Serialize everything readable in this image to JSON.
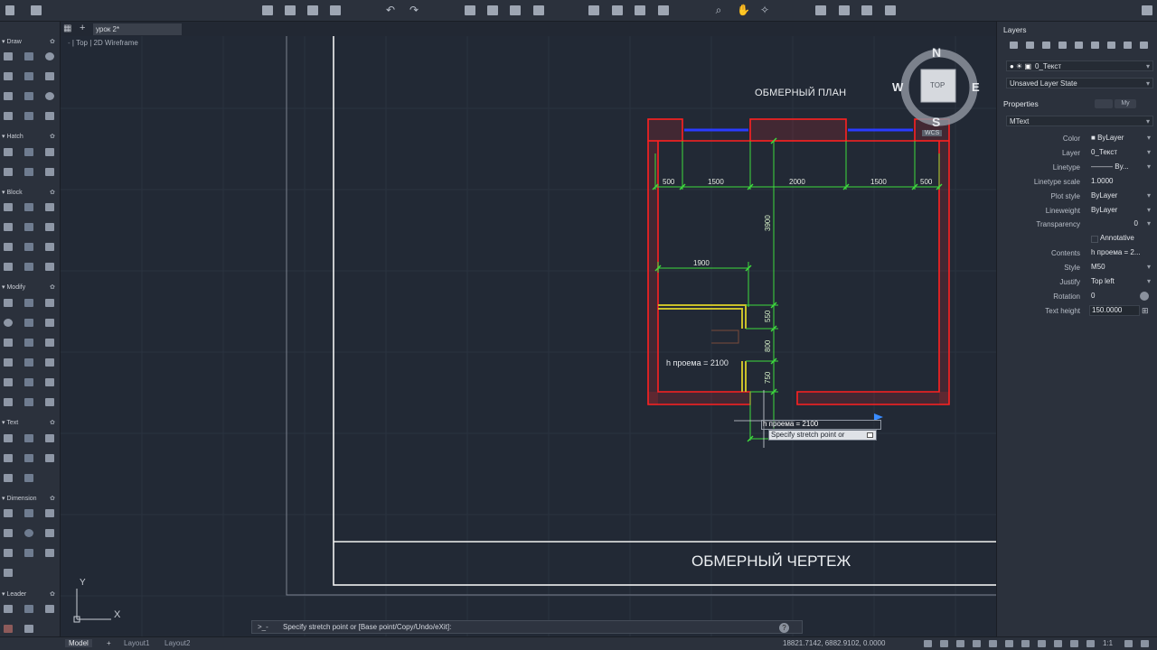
{
  "file_tab": "урок 2*",
  "view": {
    "dash": "-",
    "viewcube_label": "Top",
    "visual_style": "2D Wireframe"
  },
  "palette_sections": [
    "Draw",
    "Hatch",
    "Block",
    "Modify",
    "Text",
    "Dimension",
    "Leader"
  ],
  "compass": {
    "n": "N",
    "s": "S",
    "e": "E",
    "w": "W",
    "cube": "TOP",
    "wcs": "WCS"
  },
  "drawing": {
    "plan_title": "ОБМЕРНЫЙ ПЛАН",
    "sheet_title": "ОБМЕРНЫЙ ЧЕРТЕЖ",
    "dims_top": [
      "500",
      "1500",
      "2000",
      "1500",
      "500"
    ],
    "dim_inner": "1900",
    "dims_vertical": [
      "3900",
      "550",
      "800",
      "750"
    ],
    "opening_label": "h проема = 2100",
    "cursor_edit_text": "h проема = 2100",
    "tooltip": "Specify stretch point or"
  },
  "command": {
    "prompt": ">_-",
    "text": "Specify stretch point or [Base point/Copy/Undo/eXit]:"
  },
  "ucs": {
    "x": "X",
    "y": "Y"
  },
  "status": {
    "layouts": [
      "Model",
      "Layout1",
      "Layout2"
    ],
    "coords": "18821.7142, 6882.9102, 0.0000",
    "scale": "1:1"
  },
  "layers_panel": {
    "title": "Layers",
    "current_layer": "0_Текст",
    "layer_state": "Unsaved Layer State"
  },
  "properties_panel": {
    "title": "Properties",
    "object_type": "MText",
    "tab_my": "My",
    "rows": [
      {
        "label": "Color",
        "value": "ByLayer"
      },
      {
        "label": "Layer",
        "value": "0_Текст"
      },
      {
        "label": "Linetype",
        "value": "By..."
      },
      {
        "label": "Linetype scale",
        "value": "1.0000"
      },
      {
        "label": "Plot style",
        "value": "ByLayer"
      },
      {
        "label": "Lineweight",
        "value": "ByLayer"
      },
      {
        "label": "Transparency",
        "value": "0"
      },
      {
        "label": "",
        "value": "Annotative"
      },
      {
        "label": "Contents",
        "value": "h проема = 2..."
      },
      {
        "label": "Style",
        "value": "M50"
      },
      {
        "label": "Justify",
        "value": "Top left"
      },
      {
        "label": "Rotation",
        "value": "0"
      },
      {
        "label": "Text height",
        "value": "150.0000"
      }
    ]
  },
  "colors": {
    "wall": "#ff2020",
    "dimension": "#3ddc3d",
    "window": "#2a3cff",
    "door": "#c9c02a",
    "background": "#222935"
  }
}
